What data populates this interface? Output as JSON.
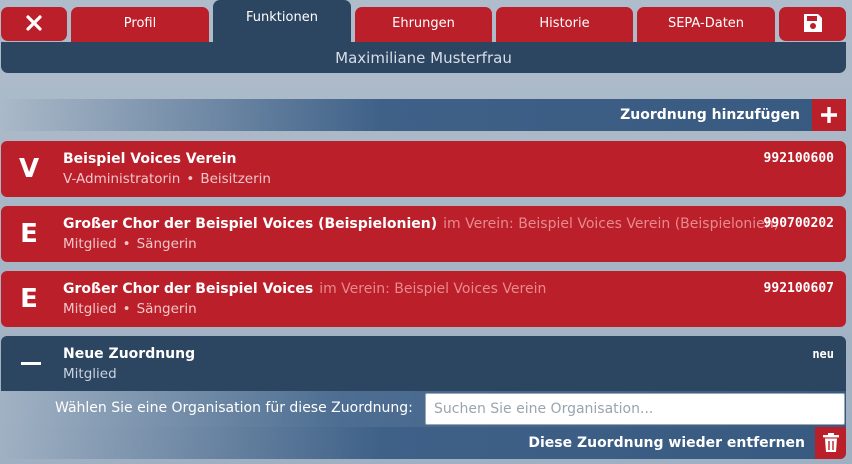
{
  "tabs": {
    "close_icon": "close-icon",
    "items": [
      {
        "label": "Profil"
      },
      {
        "label": "Funktionen"
      },
      {
        "label": "Ehrungen"
      },
      {
        "label": "Historie"
      },
      {
        "label": "SEPA-Daten"
      }
    ],
    "save_icon": "save-icon",
    "active_index": 1
  },
  "header": {
    "person_name": "Maximiliane Musterfrau"
  },
  "add_assignment": {
    "label": "Zuordnung hinzufügen",
    "icon": "plus-icon"
  },
  "assignments": [
    {
      "letter": "V",
      "name": "Beispiel Voices Verein",
      "context": "",
      "roles": [
        "V-Administratorin",
        "Beisitzerin"
      ],
      "number": "992100600"
    },
    {
      "letter": "E",
      "name": "Großer Chor der Beispiel Voices (Beispielonien)",
      "context": "im Verein: Beispiel Voices Verein (Beispielonien)",
      "roles": [
        "Mitglied",
        "Sängerin"
      ],
      "number": "990700202"
    },
    {
      "letter": "E",
      "name": "Großer Chor der Beispiel Voices",
      "context": "im Verein: Beispiel Voices Verein",
      "roles": [
        "Mitglied",
        "Sängerin"
      ],
      "number": "992100607"
    }
  ],
  "new_assignment": {
    "name": "Neue Zuordnung",
    "role": "Mitglied",
    "badge": "neu",
    "org_label": "Wählen Sie eine Organisation für diese Zuordnung:",
    "org_value": "",
    "org_placeholder": "Suchen Sie eine Organisation...",
    "remove_label": "Diese Zuordnung wieder entfernen",
    "remove_icon": "trash-icon"
  },
  "colors": {
    "accent_red": "#bb1f2a",
    "navy": "#2c4561",
    "background": "#a7b6c6"
  }
}
